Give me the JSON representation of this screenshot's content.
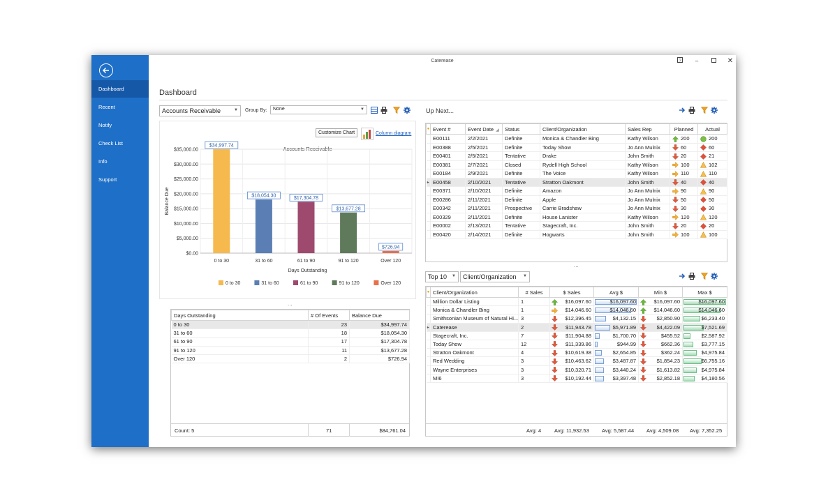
{
  "app": {
    "title": "Caterease"
  },
  "sidebar": {
    "items": [
      {
        "label": "Dashboard"
      },
      {
        "label": "Recent"
      },
      {
        "label": "Notify"
      },
      {
        "label": "Check List"
      },
      {
        "label": "Info"
      },
      {
        "label": "Support"
      }
    ]
  },
  "page": {
    "title": "Dashboard"
  },
  "left_panel": {
    "report_select": "Accounts Receivable",
    "group_by_label": "Group By:",
    "group_by_value": "None",
    "customize_chart": "Customize Chart",
    "column_diagram": "Column diagram"
  },
  "chart_data": {
    "type": "bar",
    "title": "Accounts Receivable",
    "xlabel": "Days Outstanding",
    "ylabel": "Balance Due",
    "categories": [
      "0 to 30",
      "31 to 60",
      "61 to 90",
      "91 to 120",
      "Over 120"
    ],
    "values": [
      34997.74,
      18054.3,
      17304.78,
      13677.28,
      726.94
    ],
    "data_labels": [
      "$34,997.74",
      "$18,054.30",
      "$17,304.78",
      "$13,677.28",
      "$726.94"
    ],
    "colors": [
      "#f6b94e",
      "#5b7fb4",
      "#9e4a6e",
      "#5f7a5b",
      "#e8704c"
    ],
    "yticks": [
      "$35,000.00",
      "$30,000.00",
      "$25,000.00",
      "$20,000.00",
      "$15,000.00",
      "$10,000.00",
      "$5,000.00",
      "$0.00"
    ],
    "ylim": [
      0,
      35000
    ],
    "legend": "bottom"
  },
  "summary_grid": {
    "columns": [
      "Days Outstanding",
      "# Of Events",
      "Balance Due"
    ],
    "rows": [
      [
        "0 to 30",
        "23",
        "$34,997.74"
      ],
      [
        "31 to 60",
        "18",
        "$18,054.30"
      ],
      [
        "61 to 90",
        "17",
        "$17,304.78"
      ],
      [
        "91 to 120",
        "11",
        "$13,677.28"
      ],
      [
        "Over 120",
        "2",
        "$726.94"
      ]
    ],
    "footer": [
      "Count:  5",
      "71",
      "$84,761.04"
    ]
  },
  "up_next": {
    "title": "Up Next...",
    "columns": [
      "Event #",
      "Event Date",
      "Status",
      "Client/Organization",
      "Sales Rep",
      "Planned",
      "Actual"
    ],
    "rows": [
      {
        "event": "E00111",
        "date": "2/2/2021",
        "status": "Definite",
        "client": "Monica & Chandler Bing",
        "rep": "Kathy Wilson",
        "planned": "200",
        "planned_icon": "green-up",
        "actual": "200",
        "actual_icon": "green-circle"
      },
      {
        "event": "E00388",
        "date": "2/5/2021",
        "status": "Definite",
        "client": "Today Show",
        "rep": "Jo Ann Mulnix",
        "planned": "60",
        "planned_icon": "red-down",
        "actual": "60",
        "actual_icon": "red-diamond"
      },
      {
        "event": "E00401",
        "date": "2/5/2021",
        "status": "Tentative",
        "client": "Drake",
        "rep": "John Smith",
        "planned": "20",
        "planned_icon": "red-down",
        "actual": "21",
        "actual_icon": "red-diamond"
      },
      {
        "event": "E00381",
        "date": "2/7/2021",
        "status": "Closed",
        "client": "Rydell High School",
        "rep": "Kathy Wilson",
        "planned": "100",
        "planned_icon": "orange-right",
        "actual": "102",
        "actual_icon": "orange-triangle"
      },
      {
        "event": "E00184",
        "date": "2/9/2021",
        "status": "Definite",
        "client": "The Voice",
        "rep": "Kathy Wilson",
        "planned": "110",
        "planned_icon": "orange-right",
        "actual": "110",
        "actual_icon": "orange-triangle"
      },
      {
        "event": "E00458",
        "date": "2/10/2021",
        "status": "Tentative",
        "client": "Stratton Oakmont",
        "rep": "John Smith",
        "planned": "40",
        "planned_icon": "red-down",
        "actual": "40",
        "actual_icon": "red-diamond"
      },
      {
        "event": "E00371",
        "date": "2/10/2021",
        "status": "Definite",
        "client": "Amazon",
        "rep": "Jo Ann Mulnix",
        "planned": "90",
        "planned_icon": "orange-right",
        "actual": "90",
        "actual_icon": "orange-triangle"
      },
      {
        "event": "E00286",
        "date": "2/11/2021",
        "status": "Definite",
        "client": "Apple",
        "rep": "Jo Ann Mulnix",
        "planned": "50",
        "planned_icon": "red-down",
        "actual": "50",
        "actual_icon": "red-diamond"
      },
      {
        "event": "E00342",
        "date": "2/11/2021",
        "status": "Prospective",
        "client": "Carrie Bradshaw",
        "rep": "Jo Ann Mulnix",
        "planned": "30",
        "planned_icon": "red-down",
        "actual": "30",
        "actual_icon": "red-diamond"
      },
      {
        "event": "E00329",
        "date": "2/11/2021",
        "status": "Definite",
        "client": "House Lanister",
        "rep": "Kathy Wilson",
        "planned": "120",
        "planned_icon": "orange-right",
        "actual": "120",
        "actual_icon": "orange-triangle"
      },
      {
        "event": "E00002",
        "date": "2/13/2021",
        "status": "Tentative",
        "client": "Stagecraft, Inc.",
        "rep": "John Smith",
        "planned": "20",
        "planned_icon": "red-down",
        "actual": "20",
        "actual_icon": "red-diamond"
      },
      {
        "event": "E00420",
        "date": "2/14/2021",
        "status": "Definite",
        "client": "Hogwarts",
        "rep": "John Smith",
        "planned": "100",
        "planned_icon": "orange-right",
        "actual": "100",
        "actual_icon": "orange-triangle"
      }
    ],
    "selected_row": 5
  },
  "top10": {
    "top_select": "Top 10",
    "by_select": "Client/Organization",
    "columns": [
      "Client/Organization",
      "# Sales",
      "$ Sales",
      "Avg $",
      "Min $",
      "Max $"
    ],
    "rows": [
      {
        "client": "Million Dollar Listing",
        "count": "1",
        "sales": "$16,097.60",
        "sales_icon": "green-up",
        "avg": "$16,097.60",
        "avg_frac": 1.0,
        "min": "$16,097.60",
        "min_icon": "green-up",
        "max": "$16,097.60",
        "max_frac": 1.0
      },
      {
        "client": "Monica & Chandler Bing",
        "count": "1",
        "sales": "$14,046.60",
        "sales_icon": "orange-right",
        "avg": "$14,046.60",
        "avg_frac": 0.87,
        "min": "$14,046.60",
        "min_icon": "green-up",
        "max": "$14,046.60",
        "max_frac": 0.87
      },
      {
        "client": "Smithsonian Museum of Natural Hi...",
        "count": "3",
        "sales": "$12,396.45",
        "sales_icon": "red-down",
        "avg": "$4,132.15",
        "avg_frac": 0.26,
        "min": "$2,850.90",
        "min_icon": "red-down",
        "max": "$6,233.40",
        "max_frac": 0.39
      },
      {
        "client": "Caterease",
        "count": "2",
        "sales": "$11,943.78",
        "sales_icon": "red-down",
        "avg": "$5,971.89",
        "avg_frac": 0.37,
        "min": "$4,422.09",
        "min_icon": "red-down",
        "max": "$7,521.69",
        "max_frac": 0.47
      },
      {
        "client": "Stagecraft, Inc.",
        "count": "7",
        "sales": "$11,904.88",
        "sales_icon": "red-down",
        "avg": "$1,700.70",
        "avg_frac": 0.11,
        "min": "$455.52",
        "min_icon": "red-down",
        "max": "$2,587.92",
        "max_frac": 0.16
      },
      {
        "client": "Today Show",
        "count": "12",
        "sales": "$11,339.86",
        "sales_icon": "red-down",
        "avg": "$944.99",
        "avg_frac": 0.06,
        "min": "$662.36",
        "min_icon": "red-down",
        "max": "$3,777.15",
        "max_frac": 0.23
      },
      {
        "client": "Stratton Oakmont",
        "count": "4",
        "sales": "$10,619.38",
        "sales_icon": "red-down",
        "avg": "$2,654.85",
        "avg_frac": 0.16,
        "min": "$362.24",
        "min_icon": "red-down",
        "max": "$4,975.84",
        "max_frac": 0.31
      },
      {
        "client": "Red Wedding",
        "count": "3",
        "sales": "$10,463.62",
        "sales_icon": "red-down",
        "avg": "$3,487.87",
        "avg_frac": 0.22,
        "min": "$1,854.23",
        "min_icon": "red-down",
        "max": "$6,755.16",
        "max_frac": 0.42
      },
      {
        "client": "Wayne Enterprises",
        "count": "3",
        "sales": "$10,320.71",
        "sales_icon": "red-down",
        "avg": "$3,440.24",
        "avg_frac": 0.21,
        "min": "$1,613.82",
        "min_icon": "red-down",
        "max": "$4,975.84",
        "max_frac": 0.31
      },
      {
        "client": "MI6",
        "count": "3",
        "sales": "$10,192.44",
        "sales_icon": "red-down",
        "avg": "$3,397.48",
        "avg_frac": 0.21,
        "min": "$2,852.18",
        "min_icon": "red-down",
        "max": "$4,180.56",
        "max_frac": 0.26
      }
    ],
    "selected_row": 3,
    "footer": [
      "Avg:  4",
      "Avg:  11,932.53",
      "Avg:  5,587.44",
      "Avg:  4,509.08",
      "Avg:  7,352.25"
    ]
  }
}
